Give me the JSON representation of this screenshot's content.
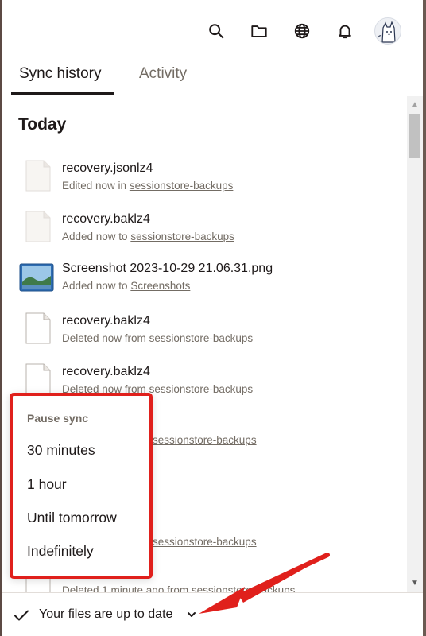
{
  "header": {
    "icons": [
      "search-icon",
      "folder-icon",
      "globe-icon",
      "bell-icon",
      "avatar"
    ]
  },
  "tabs": [
    {
      "label": "Sync history",
      "active": true
    },
    {
      "label": "Activity",
      "active": false
    }
  ],
  "main": {
    "section_title": "Today",
    "items": [
      {
        "name": "recovery.jsonlz4",
        "action": "Edited now in",
        "folder": "sessionstore-backups",
        "icon": "file-icon"
      },
      {
        "name": "recovery.baklz4",
        "action": "Added now to",
        "folder": "sessionstore-backups",
        "icon": "file-icon"
      },
      {
        "name": "Screenshot 2023-10-29 21.06.31.png",
        "action": "Added now to",
        "folder": "Screenshots",
        "icon": "image-thumbnail-icon"
      },
      {
        "name": "recovery.baklz4",
        "action": "Deleted now from",
        "folder": "sessionstore-backups",
        "icon": "file-icon"
      },
      {
        "name": "recovery.baklz4",
        "action": "Deleted now from",
        "folder": "sessionstore-backups",
        "icon": "file-icon"
      },
      {
        "name": "",
        "action": "",
        "folder": "sessionstore-backups",
        "icon": "file-icon"
      },
      {
        "name": "",
        "action": "",
        "folder": "",
        "icon": "file-icon"
      },
      {
        "name": "",
        "action": "",
        "folder": "sessionstore-backups",
        "icon": "file-icon"
      },
      {
        "name": "",
        "action": "Deleted 1 minute ago from",
        "folder": "sessionstore-backups",
        "icon": "file-icon"
      }
    ]
  },
  "pause_menu": {
    "title": "Pause sync",
    "options": [
      "30 minutes",
      "1 hour",
      "Until tomorrow",
      "Indefinitely"
    ]
  },
  "footer": {
    "status": "Your files are up to date"
  },
  "colors": {
    "annotation": "#e0201c",
    "text_primary": "#1e1919",
    "text_secondary": "#736c64"
  }
}
